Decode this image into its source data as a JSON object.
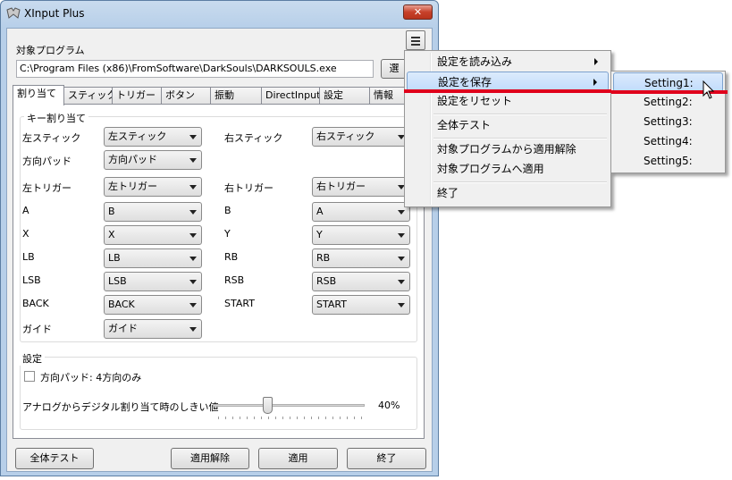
{
  "window": {
    "title": "XInput Plus",
    "close_label": "✕"
  },
  "target": {
    "label": "対象プログラム",
    "path": "C:\\Program Files (x86)\\FromSoftware\\DarkSouls\\DARKSOULS.exe",
    "browse_label": "選"
  },
  "tabs": [
    "割り当て",
    "スティック",
    "トリガー",
    "ボタン",
    "振動",
    "DirectInput",
    "設定",
    "情報"
  ],
  "assign": {
    "group_title": "キー割り当て",
    "rows": [
      {
        "l_label": "左スティック",
        "l_value": "左スティック",
        "r_label": "右スティック",
        "r_value": "右スティック"
      },
      {
        "l_label": "方向パッド",
        "l_value": "方向パッド"
      },
      {
        "l_label": "左トリガー",
        "l_value": "左トリガー",
        "r_label": "右トリガー",
        "r_value": "右トリガー"
      },
      {
        "l_label": "A",
        "l_value": "B",
        "r_label": "B",
        "r_value": "A"
      },
      {
        "l_label": "X",
        "l_value": "X",
        "r_label": "Y",
        "r_value": "Y"
      },
      {
        "l_label": "LB",
        "l_value": "LB",
        "r_label": "RB",
        "r_value": "RB"
      },
      {
        "l_label": "LSB",
        "l_value": "LSB",
        "r_label": "RSB",
        "r_value": "RSB"
      },
      {
        "l_label": "BACK",
        "l_value": "BACK",
        "r_label": "START",
        "r_value": "START"
      },
      {
        "l_label": "ガイド",
        "l_value": "ガイド"
      }
    ]
  },
  "settings": {
    "group_title": "設定",
    "dpad_checkbox_label": "方向パッド: 4方向のみ",
    "dpad_checked": false,
    "threshold_label": "アナログからデジタル割り当て時のしきい値",
    "threshold_value": "40%",
    "threshold_fraction": 0.4
  },
  "buttons": {
    "test": "全体テスト",
    "unapply": "適用解除",
    "apply": "適用",
    "exit": "終了"
  },
  "main_menu": {
    "items": [
      "設定を読み込み",
      "設定を保存",
      "設定をリセット",
      "全体テスト",
      "対象プログラムから適用解除",
      "対象プログラムへ適用",
      "終了"
    ]
  },
  "sub_menu": {
    "items": [
      "Setting1:",
      "Setting2:",
      "Setting3:",
      "Setting4:",
      "Setting5:"
    ]
  },
  "colors": {
    "highlight_line": "#e0001b",
    "title_bar": "#b7cfe9"
  }
}
